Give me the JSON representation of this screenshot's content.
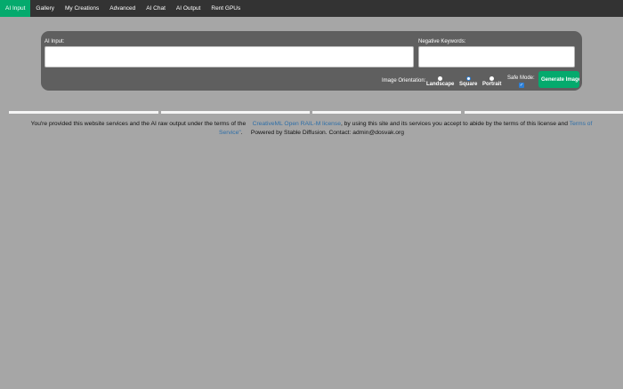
{
  "nav": {
    "items": [
      {
        "label": "AI Input",
        "active": true
      },
      {
        "label": "Gallery",
        "active": false
      },
      {
        "label": "My Creations",
        "active": false
      },
      {
        "label": "Advanced",
        "active": false
      },
      {
        "label": "AI Chat",
        "active": false
      },
      {
        "label": "AI Output",
        "active": false
      },
      {
        "label": "Rent GPUs",
        "active": false
      }
    ]
  },
  "form": {
    "ai_input_label": "AI Input:",
    "ai_input_value": "",
    "negative_label": "Negative Keywords:",
    "negative_value": "",
    "orientation_label": "Image Orientation:",
    "orientations": [
      {
        "label": "Landscape",
        "selected": false
      },
      {
        "label": "Square",
        "selected": true
      },
      {
        "label": "Portrait",
        "selected": false
      }
    ],
    "safe_mode_label": "Safe Mode:",
    "safe_mode_checked": true,
    "generate_button": "Generate Image"
  },
  "footer": {
    "text1": "You're provided this website services and the AI raw output under the terms of the",
    "license_link": "CreativeML Open RAIL-M license",
    "text2": ", by using this site and its services you accept to abide by the terms of this license and",
    "tos_link_part1": "Terms of",
    "tos_link_part2": "Service\"",
    "text3": ".     Powered by Stable Diffusion. Contact: admin@dosvak.org"
  },
  "colors": {
    "nav_bg": "#333333",
    "accent": "#04aa6d",
    "panel_bg": "#5f5f5f",
    "page_bg": "#a6a6a6",
    "link": "#2f6fa8"
  }
}
